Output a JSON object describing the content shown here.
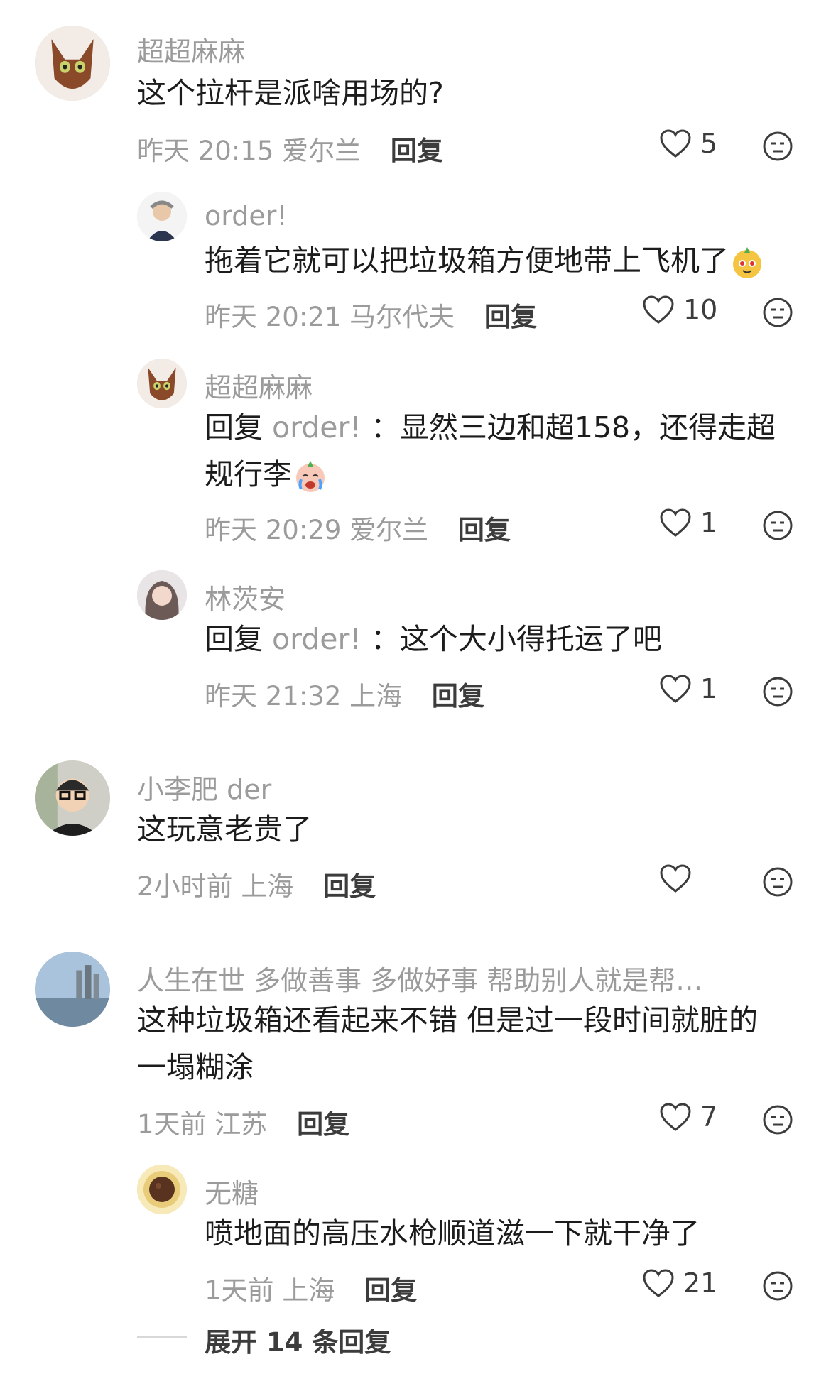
{
  "comments": [
    {
      "name": "超超麻麻",
      "text": "这个拉杆是派啥用场的?",
      "time": "昨天 20:15",
      "location": "爱尔兰",
      "reply_label": "回复",
      "likes": "5"
    },
    {
      "name": "order!",
      "text": "拖着它就可以把垃圾箱方便地带上飞机了",
      "time": "昨天 20:21",
      "location": "马尔代夫",
      "reply_label": "回复",
      "likes": "10"
    },
    {
      "name": "超超麻麻",
      "reply_prefix": "回复",
      "mention": "order!",
      "text_line1": "：显然三边和超158，还得走超",
      "text_line2": "规行李",
      "time": "昨天 20:29",
      "location": "爱尔兰",
      "reply_label": "回复",
      "likes": "1"
    },
    {
      "name": "林茨安",
      "reply_prefix": "回复",
      "mention": "order!",
      "text": "：这个大小得托运了吧",
      "time": "昨天 21:32",
      "location": "上海",
      "reply_label": "回复",
      "likes": "1"
    },
    {
      "name": "小李肥 der",
      "text": "这玩意老贵了",
      "time": "2小时前",
      "location": "上海",
      "reply_label": "回复",
      "likes": ""
    },
    {
      "name": "人生在世 多做善事 多做好事 帮助别人就是帮…",
      "text_line1": "这种垃圾箱还看起来不错 但是过一段时间就脏的",
      "text_line2": "一塌糊涂",
      "time": "1天前",
      "location": "江苏",
      "reply_label": "回复",
      "likes": "7"
    },
    {
      "name": "无糖",
      "text": "喷地面的高压水枪顺道滋一下就干净了",
      "time": "1天前",
      "location": "上海",
      "reply_label": "回复",
      "likes": "21"
    }
  ],
  "expand_label": "展开 14 条回复",
  "icons": {
    "like": "heart-outline-icon",
    "dislike": "meh-face-icon"
  },
  "colors": {
    "name": "#9b9b9b",
    "text": "#1c1c1c",
    "meta": "#9b9b9b",
    "reply": "#3c3c3c"
  }
}
